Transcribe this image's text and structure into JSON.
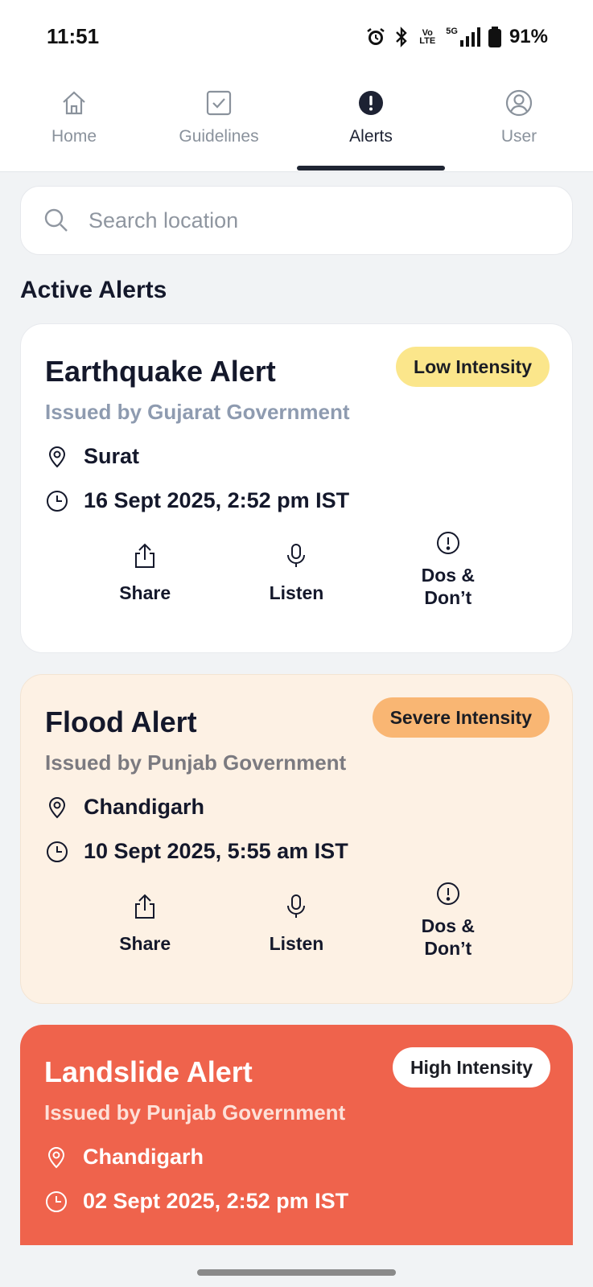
{
  "status": {
    "time": "11:51",
    "battery": "91%",
    "network_label": "5G",
    "volte_label": "Vo LTE",
    "icons": [
      "alarm-icon",
      "bluetooth-icon",
      "volte-icon",
      "signal-icon",
      "battery-icon"
    ]
  },
  "tabs": [
    {
      "label": "Home",
      "icon": "home-icon"
    },
    {
      "label": "Guidelines",
      "icon": "checkbox-icon"
    },
    {
      "label": "Alerts",
      "icon": "alert-icon",
      "active": true
    },
    {
      "label": "User",
      "icon": "user-icon"
    }
  ],
  "search": {
    "placeholder": "Search location",
    "icon": "search-icon"
  },
  "section_title": "Active Alerts",
  "alerts": [
    {
      "title": "Earthquake Alert",
      "issuer": "Issued by Gujarat Government",
      "badge": "Low Intensity",
      "location": "Surat",
      "time": "16 Sept 2025, 2:52 pm IST",
      "theme": "#ffffff",
      "badge_color": "#fbe68b"
    },
    {
      "title": "Flood Alert",
      "issuer": "Issued by Punjab Government",
      "badge": "Severe Intensity",
      "location": "Chandigarh",
      "time": "10 Sept 2025, 5:55 am IST",
      "theme": "#fdf1e4",
      "badge_color": "#f9b673"
    },
    {
      "title": "Landslide Alert",
      "issuer": "Issued by Punjab Government",
      "badge": "High Intensity",
      "location": "Chandigarh",
      "time": "02 Sept 2025, 2:52 pm IST",
      "theme": "#ef634c",
      "badge_color": "#ffffff"
    }
  ],
  "actions": {
    "share": "Share",
    "listen": "Listen",
    "dos_line1": "Dos &",
    "dos_line2": "Don’t"
  }
}
